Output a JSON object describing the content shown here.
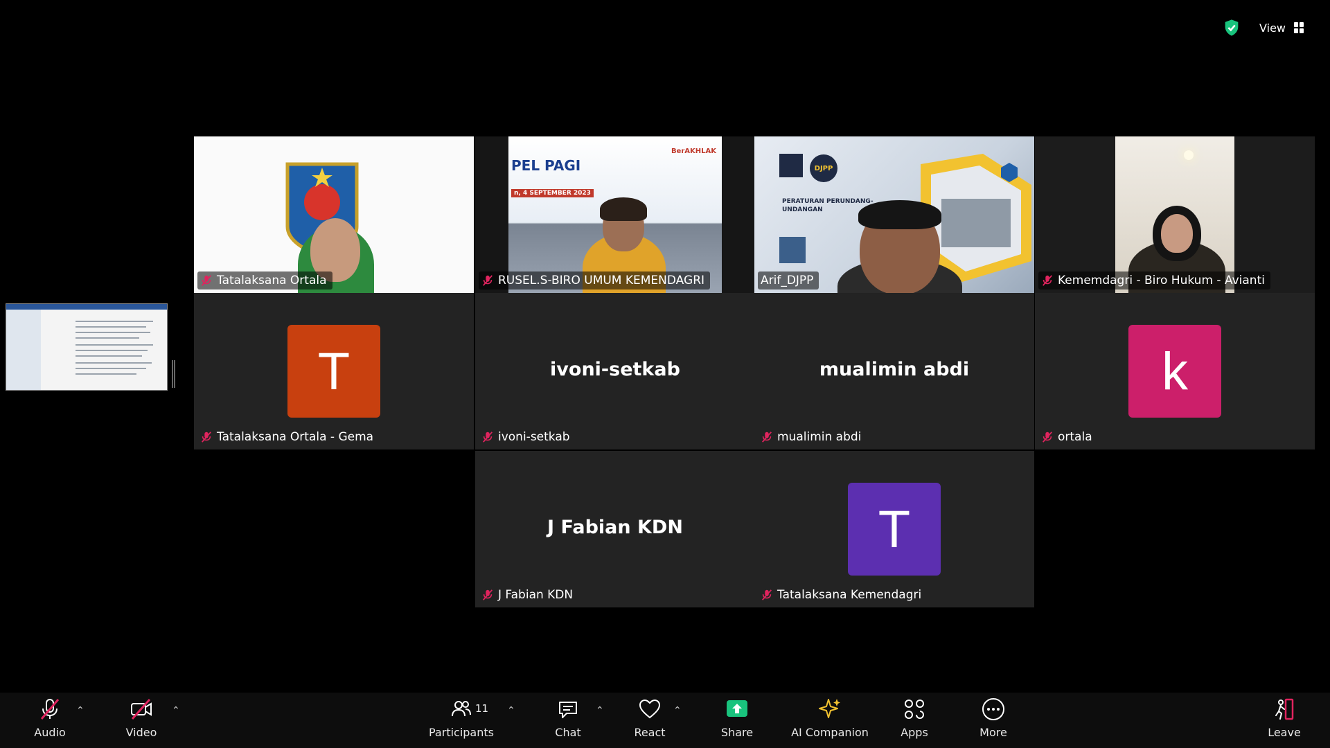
{
  "topbar": {
    "view_label": "View"
  },
  "grid": {
    "video_tiles": [
      {
        "name": "Tatalaksana Ortala",
        "muted": true
      },
      {
        "name": "RUSEL.S-BIRO UMUM KEMENDAGRI",
        "muted": true,
        "bg_title": "PEL PAGI",
        "bg_date": "n, 4 SEPTEMBER 2023",
        "bg_logo": "BerAKHLAK"
      },
      {
        "name": "Arif_DJPP",
        "muted": false,
        "active": true,
        "bg_badge": "DJPP",
        "bg_title": "PERATURAN PERUNDANG-UNDANGAN"
      },
      {
        "name": "Kememdagri - Biro Hukum - Avianti",
        "muted": true
      }
    ],
    "avatar_tiles": [
      {
        "name": "Tatalaksana Ortala - Gema",
        "initial": "T",
        "color": "#c8400f"
      },
      {
        "name": "ivoni-setkab",
        "display": "ivoni-setkab"
      },
      {
        "name": "mualimin abdi",
        "display": "mualimin abdi"
      },
      {
        "name": "ortala",
        "initial": "k",
        "color": "#cc1f6a"
      },
      {
        "name": "J Fabian KDN",
        "display": "J Fabian KDN"
      },
      {
        "name": "Tatalaksana Kemendagri",
        "initial": "T",
        "color": "#5c2fb0"
      }
    ]
  },
  "toolbar": {
    "audio": "Audio",
    "video": "Video",
    "participants": "Participants",
    "participants_count": "11",
    "chat": "Chat",
    "react": "React",
    "share": "Share",
    "ai_companion": "AI Companion",
    "apps": "Apps",
    "more": "More",
    "leave": "Leave"
  },
  "colors": {
    "active_speaker": "#2ed573",
    "share": "#19c37d",
    "muted": "#e0245e"
  }
}
